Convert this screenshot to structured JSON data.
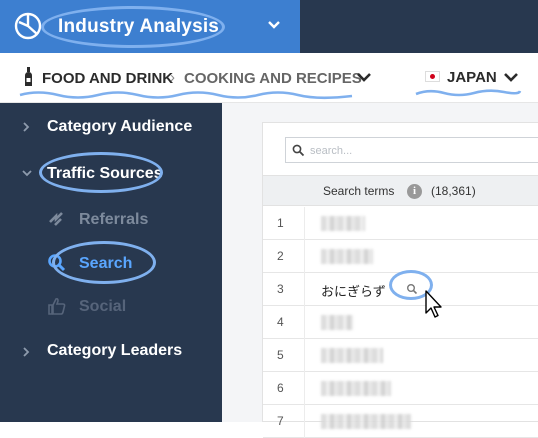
{
  "app": {
    "title": "Industry Analysis",
    "logo_icon": "pie-chart-icon",
    "switch_icon": "chevron-down-icon"
  },
  "breadcrumb": {
    "category": "FOOD AND DRINK",
    "separator": "›",
    "subcategory": "COOKING AND RECIPES",
    "country": "JAPAN",
    "country_flag": "japan-flag-icon"
  },
  "sidebar": {
    "items": [
      {
        "label": "Category Audience",
        "expanded": false
      },
      {
        "label": "Traffic Sources",
        "expanded": true,
        "children": [
          {
            "label": "Referrals",
            "icon": "referrals-icon",
            "active": false
          },
          {
            "label": "Search",
            "icon": "search-icon",
            "active": true
          },
          {
            "label": "Social",
            "icon": "thumbs-up-icon",
            "active": false
          }
        ]
      },
      {
        "label": "Category Leaders",
        "expanded": false
      }
    ]
  },
  "table": {
    "search_placeholder": "search...",
    "header_label": "Search terms",
    "header_count": "(18,361)",
    "info_glyph": "i",
    "rows": [
      {
        "rank": "1",
        "term": ""
      },
      {
        "rank": "2",
        "term": ""
      },
      {
        "rank": "3",
        "term": "おにぎらず"
      },
      {
        "rank": "4",
        "term": ""
      },
      {
        "rank": "5",
        "term": ""
      },
      {
        "rank": "6",
        "term": ""
      },
      {
        "rank": "7",
        "term": ""
      }
    ]
  },
  "colors": {
    "top_bar": "#28384f",
    "app_switch": "#3d7fd0",
    "sidebar": "#28384f",
    "active_item": "#5aa6ff",
    "muted_item": "#7d8a9c",
    "highlight": "#7fb0ee"
  }
}
